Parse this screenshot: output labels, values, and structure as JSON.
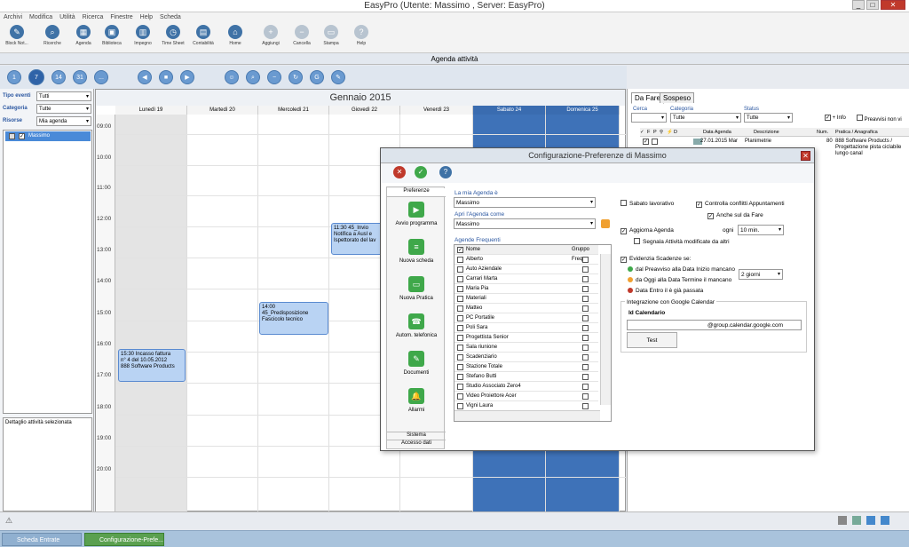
{
  "window": {
    "title": "EasyPro (Utente: Massimo , Server: EasyPro)"
  },
  "menu": [
    "Archivi",
    "Modifica",
    "Utilità",
    "Ricerca",
    "Finestre",
    "Help",
    "Scheda"
  ],
  "toolbar": [
    {
      "label": "Block Not...",
      "icon": "notepad-icon"
    },
    {
      "label": "Ricerche",
      "icon": "search-icon"
    },
    {
      "label": "Agenda",
      "icon": "calendar-icon"
    },
    {
      "label": "Biblioteca",
      "icon": "library-icon"
    },
    {
      "label": "Impegno",
      "icon": "chart-icon"
    },
    {
      "label": "Time Sheet",
      "icon": "clock-icon"
    },
    {
      "label": "Contabilità",
      "icon": "calculator-icon"
    },
    {
      "label": "Home",
      "icon": "home-icon"
    },
    {
      "label": "Aggiungi",
      "icon": "add-icon"
    },
    {
      "label": "Cancella",
      "icon": "delete-icon"
    },
    {
      "label": "Stampa",
      "icon": "print-icon"
    },
    {
      "label": "Help",
      "icon": "help-icon"
    }
  ],
  "agenda": {
    "header": "Agenda attività",
    "month": "Gennaio 2015",
    "view_buttons": [
      "1",
      "7",
      "14",
      "31",
      "..."
    ],
    "days": [
      "Lunedì 19",
      "Martedì 20",
      "Mercoledì 21",
      "Giovedì 22",
      "Venerdì 23",
      "Sabato 24",
      "Domenica 25"
    ],
    "times": [
      "09:00",
      "10:00",
      "11:00",
      "12:00",
      "13:00",
      "14:00",
      "15:00",
      "16:00",
      "17:00",
      "18:00",
      "19:00",
      "20:00"
    ],
    "events": [
      {
        "line1": "15:30 Incasso fattura",
        "line2": "n° 4 del 10.05.2012",
        "line3": "888 Software Products"
      },
      {
        "line1": "14:00",
        "line2": "45_Predisposizione",
        "line3": "Fascicolo tecnico"
      },
      {
        "line1": "11:30 45_Invio",
        "line2": "Notifica a Ausl e",
        "line3": "Ispettorato del lav"
      }
    ]
  },
  "filters": {
    "tipo_label": "Tipo eventi",
    "tipo_value": "Tutti",
    "cat_label": "Categoria",
    "cat_value": "Tutte",
    "ris_label": "Risorse",
    "ris_value": "Mia agenda",
    "resource": "Massimo",
    "detail_label": "Dettaglio attività selezionata"
  },
  "right": {
    "tab1": "Da Fare",
    "tab2": "Sospeso",
    "cerca": "Cerca",
    "categoria": "Categoria",
    "categoria_value": "Tutte",
    "status": "Status",
    "status_value": "Tutte",
    "info": "+ Info",
    "preavvisi": "Preavvisi non vi",
    "cols": [
      "Data Agenda",
      "Descrizione",
      "Num.",
      "Pratica / Anagrafica"
    ],
    "row": {
      "date": "27.01.2015 Mar",
      "desc": "Planimetrie",
      "num": "80",
      "pratica": "888 Software Products / Progettazione pista ciclabile lungo canal"
    }
  },
  "dialog": {
    "title": "Configurazione-Preferenze di Massimo",
    "nav_header": "Preferenze",
    "nav": [
      "Avvio programma",
      "Nuova scheda",
      "Nuova Pratica",
      "Autom. telefonica",
      "Documenti",
      "Allarmi"
    ],
    "nav_footer1": "Sistema",
    "nav_footer2": "Accesso dati",
    "mia_agenda_label": "La mia Agenda è",
    "mia_agenda_value": "Massimo",
    "apri_label": "Apri l'Agenda come",
    "apri_value": "Massimo",
    "frequenti_label": "Agende Frequenti",
    "col_nome": "Nome",
    "col_gruppo": "Gruppo Freq.",
    "agende": [
      "Alberto",
      "Auto Aziendale",
      "Carrari Marta",
      "Maria Pia",
      "Materiali",
      "Matteo",
      "PC Portatile",
      "Poli Sara",
      "Progettista Senior",
      "Sala riunione",
      "Scadenziario",
      "Stazione Totale",
      "Stefano Butti",
      "Studio Associato Zero4",
      "Video Proiettore Acer",
      "Vigni Laura"
    ],
    "sabato": "Sabato lavorativo",
    "conflitti": "Controlla conflitti Appuntamenti",
    "anche_fare": "Anche sul da Fare",
    "aggiorna": "Aggiorna Agenda",
    "ogni": "ogni",
    "ogni_value": "10 min.",
    "segnala": "Segnala Attività modificate da altri",
    "evidenzia": "Evidenzia Scadenze se:",
    "scad1": "dal Preavviso alla Data Inizio mancano",
    "scad2": "da Oggi alla Data Termine il mancano",
    "scad3": "Data Entro il è già passata",
    "giorni": "2 giorni",
    "google_group": "Integrazione con Google Calendar",
    "id_cal": "Id Calendario",
    "cal_suffix": "@group.calendar.google.com",
    "test": "Test"
  },
  "taskbar": [
    "Scheda Entrate",
    "Configurazione-Prefe..."
  ]
}
